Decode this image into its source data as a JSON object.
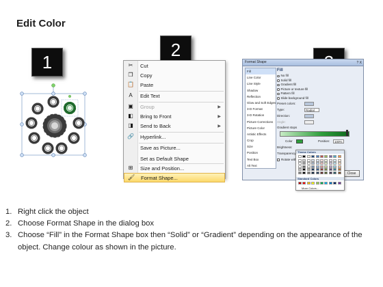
{
  "page": {
    "title": "Edit Color"
  },
  "badges": [
    "1",
    "2",
    "3"
  ],
  "context_menu": {
    "items": [
      {
        "label": "Cut",
        "icon": "scissors-icon",
        "glyph": "✂",
        "enabled": true,
        "submenu": false
      },
      {
        "label": "Copy",
        "icon": "copy-icon",
        "glyph": "❐",
        "enabled": true,
        "submenu": false
      },
      {
        "label": "Paste",
        "icon": "paste-icon",
        "glyph": "📋",
        "enabled": true,
        "submenu": false
      },
      {
        "label": "Edit Text",
        "icon": "edit-text-icon",
        "glyph": "A",
        "enabled": true,
        "submenu": false
      },
      {
        "label": "Group",
        "icon": "group-icon",
        "glyph": "▣",
        "enabled": false,
        "submenu": true
      },
      {
        "label": "Bring to Front",
        "icon": "bring-front-icon",
        "glyph": "◧",
        "enabled": true,
        "submenu": true
      },
      {
        "label": "Send to Back",
        "icon": "send-back-icon",
        "glyph": "◨",
        "enabled": true,
        "submenu": true
      },
      {
        "label": "Hyperlink...",
        "icon": "hyperlink-icon",
        "glyph": "🔗",
        "enabled": true,
        "submenu": false
      },
      {
        "label": "Save as Picture...",
        "icon": "",
        "glyph": "",
        "enabled": true,
        "submenu": false
      },
      {
        "label": "Set as Default Shape",
        "icon": "",
        "glyph": "",
        "enabled": true,
        "submenu": false
      },
      {
        "label": "Size and Position...",
        "icon": "size-position-icon",
        "glyph": "⊞",
        "enabled": true,
        "submenu": false
      },
      {
        "label": "Format Shape...",
        "icon": "format-shape-icon",
        "glyph": "🖌",
        "enabled": true,
        "submenu": false,
        "highlighted": true
      }
    ]
  },
  "format_dialog": {
    "title": "Format Shape",
    "controls": "?  X",
    "sidebar": [
      "Fill",
      "Line Color",
      "Line Style",
      "Shadow",
      "Reflection",
      "Glow and Soft Edges",
      "3-D Format",
      "3-D Rotation",
      "Picture Corrections",
      "Picture Color",
      "Artistic Effects",
      "Crop",
      "Size",
      "Position",
      "Text Box",
      "Alt Text"
    ],
    "selected_sidebar": "Fill",
    "fill_header": "Fill",
    "fill_options": [
      {
        "label": "No fill",
        "selected": false
      },
      {
        "label": "Solid fill",
        "selected": false
      },
      {
        "label": "Gradient fill",
        "selected": true
      },
      {
        "label": "Picture or texture fill",
        "selected": false
      },
      {
        "label": "Pattern fill",
        "selected": false
      },
      {
        "label": "Slide background fill",
        "selected": false
      }
    ],
    "preset_colors_label": "Preset colors:",
    "type_label": "Type:",
    "type_value": "Radial",
    "direction_label": "Direction:",
    "angle_label": "Angle:",
    "gradient_stops_label": "Gradient stops",
    "color_label": "Color",
    "position_label": "Position:",
    "position_value": "100%",
    "brightness_label": "Brightness:",
    "transparency_label": "Transparency:",
    "rotate_label": "Rotate with shape",
    "close_label": "Close",
    "accent": "#2e9e3c"
  },
  "palette": {
    "theme_header": "Theme Colors",
    "standard_header": "Standard Colors",
    "more_label": "More Colors..."
  },
  "instructions": [
    {
      "num": "1.",
      "text": "Right click the object"
    },
    {
      "num": "2.",
      "text": "Choose Format Shape in the dialog box"
    },
    {
      "num": "3.",
      "text": "Choose “Fill” in the Format Shape box then “Solid” or “Gradient” depending on the appearance of the object. Change colour as shown in the picture."
    }
  ]
}
